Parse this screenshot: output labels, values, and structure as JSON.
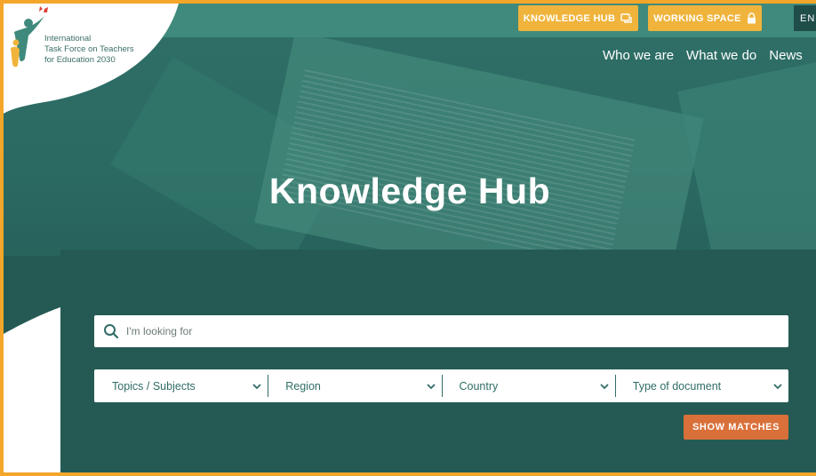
{
  "topbar": {
    "knowledge_hub_label": "KNOWLEDGE HUB",
    "working_space_label": "WORKING SPACE",
    "language": "EN"
  },
  "logo": {
    "line1": "International",
    "line2": "Task Force on Teachers",
    "line3": "for Education 2030"
  },
  "nav": {
    "items": [
      "Who we are",
      "What we do",
      "News"
    ]
  },
  "hero": {
    "title": "Knowledge Hub"
  },
  "search": {
    "placeholder": "I'm looking for"
  },
  "filters": {
    "items": [
      "Topics / Subjects",
      "Region",
      "Country",
      "Type of document"
    ]
  },
  "actions": {
    "show_matches_label": "SHOW MATCHES"
  },
  "colors": {
    "frame": "#f4a62a",
    "teal_dark": "#255a54",
    "teal_bar": "#3f8a7c",
    "yellow_button": "#f0b43c",
    "orange_button": "#d9703a"
  }
}
